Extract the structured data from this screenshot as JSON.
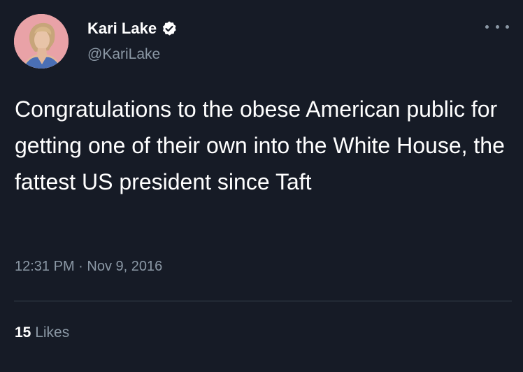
{
  "author": {
    "display_name": "Kari Lake",
    "handle": "@KariLake",
    "verified": true,
    "avatar_bg_color": "#E9A2A7"
  },
  "tweet": {
    "text": "Congratulations to the obese American public for getting one of their own into the White House, the fattest US president since Taft",
    "timestamp": "12:31 PM · Nov 9, 2016"
  },
  "stats": {
    "likes_count": "15",
    "likes_label": "Likes"
  },
  "icons": {
    "verified": "verified-badge-icon",
    "more": "more-options-icon"
  },
  "colors": {
    "background": "#161B26",
    "primary_text": "#FFFFFF",
    "secondary_text": "#8B98A5",
    "divider": "#38444D"
  }
}
